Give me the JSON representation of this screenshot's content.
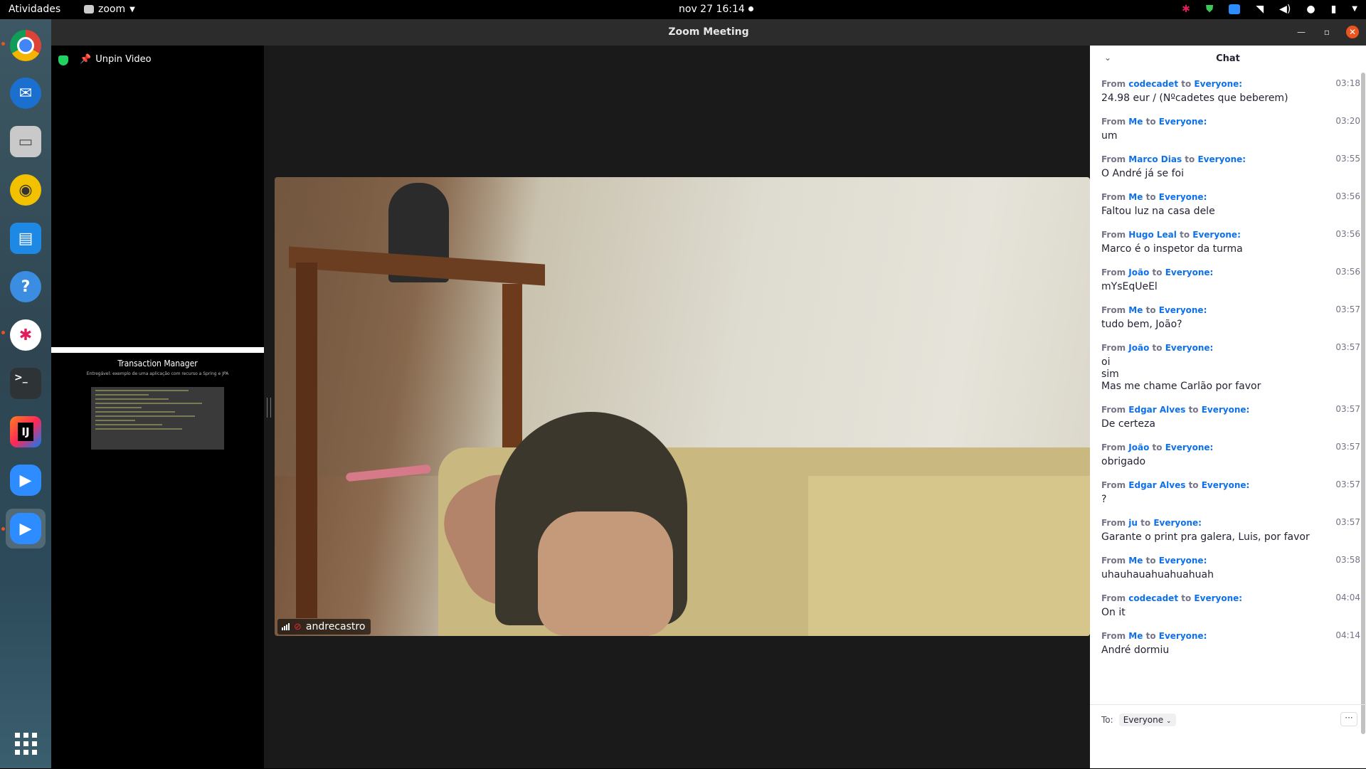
{
  "topbar": {
    "activities": "Atividades",
    "app_name": "zoom",
    "clock": "nov 27  16:14"
  },
  "window": {
    "title": "Zoom Meeting"
  },
  "sidepanel": {
    "unpin_label": "Unpin Video",
    "share_title": "Transaction Manager",
    "share_subtitle": "Entregável: exemplo de uma aplicação com recurso a Spring e JPA"
  },
  "video": {
    "participant_name": "andrecastro"
  },
  "chat": {
    "title": "Chat",
    "messages": [
      {
        "from": "codecadet",
        "to": "Everyone:",
        "time": "03:18",
        "text": "24.98 eur / (Nºcadetes que beberem)"
      },
      {
        "from": "Me",
        "to": "Everyone:",
        "time": "03:20",
        "text": "um"
      },
      {
        "from": "Marco Dias",
        "to": "Everyone:",
        "time": "03:55",
        "text": "O André já se foi"
      },
      {
        "from": "Me",
        "to": "Everyone:",
        "time": "03:56",
        "text": "Faltou luz na casa dele"
      },
      {
        "from": "Hugo Leal",
        "to": "Everyone:",
        "time": "03:56",
        "text": "Marco é o inspetor da turma"
      },
      {
        "from": "João",
        "to": "Everyone:",
        "time": "03:56",
        "text": "mYsEqUeEl"
      },
      {
        "from": "Me",
        "to": "Everyone:",
        "time": "03:57",
        "text": "tudo bem, João?"
      },
      {
        "from": "João",
        "to": "Everyone:",
        "time": "03:57",
        "text": "oi\nsim\nMas me chame Carlão por favor"
      },
      {
        "from": "Edgar Alves",
        "to": "Everyone:",
        "time": "03:57",
        "text": "De certeza"
      },
      {
        "from": "João",
        "to": "Everyone:",
        "time": "03:57",
        "text": "obrigado"
      },
      {
        "from": "Edgar Alves",
        "to": "Everyone:",
        "time": "03:57",
        "text": "?"
      },
      {
        "from": "ju",
        "to": "Everyone:",
        "time": "03:57",
        "text": "Garante o print pra galera, Luis, por favor"
      },
      {
        "from": "Me",
        "to": "Everyone:",
        "time": "03:58",
        "text": "uhauhauahuahuahuah"
      },
      {
        "from": "codecadet",
        "to": "Everyone:",
        "time": "04:04",
        "text": "On it"
      },
      {
        "from": "Me",
        "to": "Everyone:",
        "time": "04:14",
        "text": "André dormiu"
      }
    ],
    "from_word": "From",
    "to_word": "to",
    "footer": {
      "to_label": "To:",
      "recipient": "Everyone",
      "more": "···"
    }
  }
}
